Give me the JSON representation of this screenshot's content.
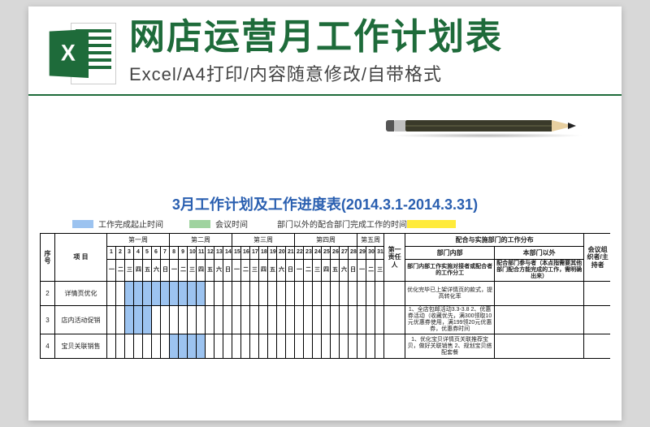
{
  "header": {
    "icon_letter": "X",
    "title": "网店运营月工作计划表",
    "subtitle": "Excel/A4打印/内容随意修改/自带格式"
  },
  "chart_data": {
    "type": "table",
    "title": "3月工作计划及工作进度表(2014.3.1-2014.3.31)",
    "legend": {
      "blue_label": "工作完成起止时间",
      "green_label": "会议时间",
      "yellow_label": "部门以外的配合部门完成工作的时间"
    },
    "header": {
      "seq": "序号",
      "project": "项 目",
      "weeks": [
        "第一周",
        "第二周",
        "第三周",
        "第四周",
        "第五周"
      ],
      "days_num": [
        "1",
        "2",
        "3",
        "4",
        "5",
        "6",
        "7",
        "8",
        "9",
        "10",
        "11",
        "12",
        "13",
        "14",
        "15",
        "16",
        "17",
        "18",
        "19",
        "20",
        "21",
        "22",
        "23",
        "24",
        "25",
        "26",
        "27",
        "28",
        "29",
        "30",
        "31"
      ],
      "days_wd": [
        "一",
        "二",
        "三",
        "四",
        "五",
        "六",
        "日",
        "一",
        "二",
        "三",
        "四",
        "五",
        "六",
        "日",
        "一",
        "二",
        "三",
        "四",
        "五",
        "六",
        "日",
        "一",
        "二",
        "三",
        "四",
        "五",
        "六",
        "日",
        "一",
        "二",
        "三"
      ],
      "owner": "第一责任人",
      "coop_title": "配合与实施部门的工作分布",
      "inner_dept": "部门内部",
      "outer_dept": "本部门以外",
      "inner_detail": "部门内部工作实施对接者或配合者的工作分工",
      "outer_detail": "配合部门参与者（本点指需要其他部门配合方能完成的工作，需明确出来）",
      "meeting": "会议组织者/主持者"
    },
    "rows": [
      {
        "seq": "2",
        "project": "详情页优化",
        "gantt": [
          0,
          0,
          1,
          1,
          1,
          1,
          1,
          1,
          1,
          1,
          1,
          0,
          0,
          0,
          0,
          0,
          0,
          0,
          0,
          0,
          0,
          0,
          0,
          0,
          0,
          0,
          0,
          0,
          0,
          0,
          0
        ],
        "inner": "优化完毕已上架详情页的款式，提高转化率"
      },
      {
        "seq": "3",
        "project": "店内活动促销",
        "gantt": [
          0,
          0,
          1,
          1,
          1,
          0,
          0,
          0,
          0,
          0,
          0,
          0,
          0,
          0,
          0,
          0,
          0,
          0,
          0,
          0,
          0,
          0,
          0,
          0,
          0,
          0,
          0,
          0,
          0,
          0,
          0
        ],
        "inner": "1、全店包邮活动3.3-3.8   2、优惠券活动（收藏优先，满300领取10元优惠券使用，满199领20元优惠券，优惠券时间"
      },
      {
        "seq": "4",
        "project": "宝贝关联销售",
        "gantt": [
          0,
          0,
          0,
          0,
          0,
          0,
          0,
          1,
          1,
          1,
          1,
          0,
          0,
          0,
          0,
          0,
          0,
          0,
          0,
          0,
          0,
          0,
          0,
          0,
          0,
          0,
          0,
          0,
          0,
          0,
          0
        ],
        "inner": "1、优化宝贝详情页关联推荐宝贝，做好关联销售   2、规划宝贝搭配套餐"
      }
    ]
  }
}
